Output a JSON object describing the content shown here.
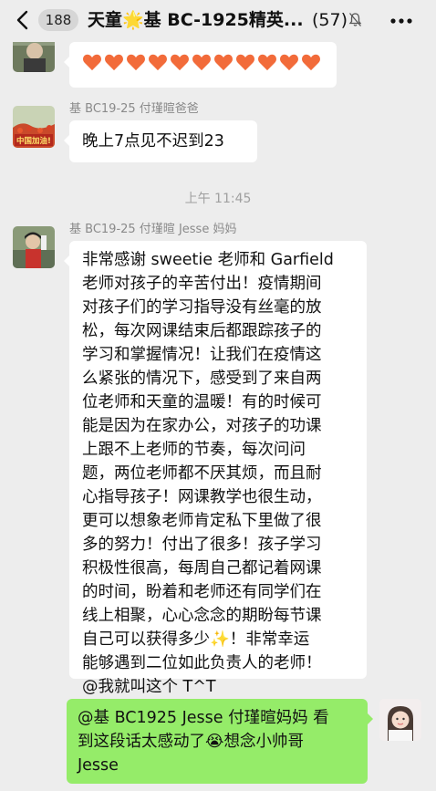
{
  "header": {
    "unread_count": "188",
    "title": "天童🌟基 BC-1925精英...",
    "member_count": "(57)"
  },
  "messages": {
    "m1": {
      "heart_count": 11
    },
    "m2": {
      "sender": "基 BC19-25 付瑾暄爸爸",
      "avatar_text": "中国加油!",
      "text": "晚上7点见不迟到23"
    },
    "timestamp": "上午 11:45",
    "m3": {
      "sender": "基 BC19-25 付瑾暄 Jesse 妈妈",
      "lines": [
        "非常感谢 sweetie 老师和 Garfield",
        "老师对孩子的辛苦付出！疫情期间",
        "对孩子们的学习指导没有丝毫的放",
        "松，每次网课结束后都跟踪孩子的",
        "学习和掌握情况！让我们在疫情这",
        "么紧张的情况下，感受到了来自两",
        "位老师和天童的温暖！有的时候可",
        "能是因为在家办公，对孩子的功课",
        "上跟不上老师的节奏，每次问问",
        "题，两位老师都不厌其烦，而且耐",
        "心指导孩子！网课教学也很生动，",
        "更可以想象老师肯定私下里做了很",
        "多的努力！付出了很多！孩子学习",
        "积极性很高，每周自己都记着网课",
        "的时间，盼着和老师还有同学们在",
        "线上相聚，心心念念的期盼每节课",
        "自己可以获得多少✨！非常幸运",
        "能够遇到二位如此负责人的老师！",
        "@我就叫这个 T^T"
      ]
    },
    "m4": {
      "lines": [
        "@基 BC1925 Jesse  付瑾暄妈妈 看",
        "到这段话太感动了😭想念小帅哥",
        "Jesse"
      ]
    }
  },
  "colors": {
    "background": "#ededed",
    "bubble_incoming": "#ffffff",
    "bubble_outgoing": "#95ec69",
    "heart": "#f26b3a"
  }
}
